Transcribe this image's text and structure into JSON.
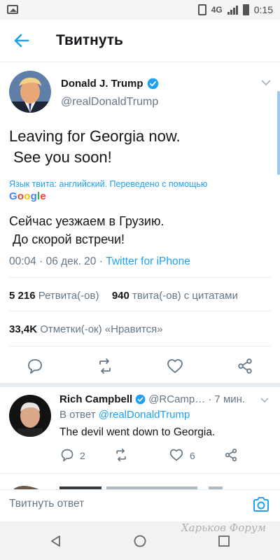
{
  "status_bar": {
    "network": "4G",
    "time": "0:15"
  },
  "header": {
    "title": "Твитнуть"
  },
  "tweet": {
    "author_name": "Donald J. Trump",
    "author_handle": "@realDonaldTrump",
    "text": "Leaving for Georgia now.\n See you soon!",
    "translation_label": "Язык твита: английский. Переведено с помощью",
    "translator_logo": "Google",
    "translated_text": "Сейчас уезжаем в Грузию.\n До скорой встречи!",
    "time": "00:04",
    "date": "06 дек. 20",
    "source": "Twitter for iPhone",
    "retweets_count": "5 216",
    "retweets_label": "Ретвита(-ов)",
    "quotes_count": "940",
    "quotes_label": "твита(-ов) с цитатами",
    "likes_count": "33,4K",
    "likes_label": "Отметки(-ок) «Нравится»"
  },
  "reply": {
    "author_name": "Rich Campbell",
    "author_handle": "@RCamp…",
    "time_ago": "· 7 мин.",
    "in_reply_prefix": "В ответ",
    "in_reply_mention": "@realDonaldTrump",
    "text": "The devil went down to Georgia.",
    "reply_count": "2",
    "like_count": "6"
  },
  "compose": {
    "placeholder": "Твитнуть ответ"
  },
  "watermark": "Харьков Форум",
  "colors": {
    "accent": "#1da1f2",
    "text": "#14171a",
    "muted": "#657786"
  }
}
